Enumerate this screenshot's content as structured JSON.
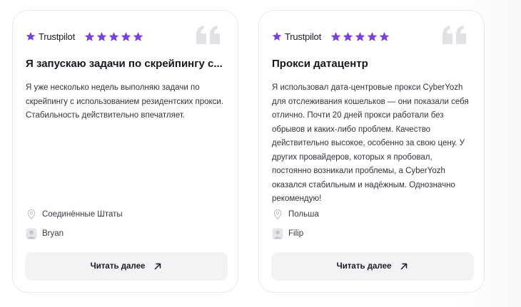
{
  "colors": {
    "accent_purple": "#7b3fe4",
    "quote_gray": "#e2e2e6",
    "button_bg": "#f3f3f5"
  },
  "reviews": [
    {
      "platform": "Trustpilot",
      "rating": 5,
      "title": "Я запускаю задачи по скрейпингу с...",
      "body": "Я уже несколько недель выполняю задачи по скрейпингу с использованием резидентских прокси. Стабильность действительно впечатляет.",
      "location": "Соединённые Штаты",
      "author": "Bryan",
      "read_more_label": "Читать далее"
    },
    {
      "platform": "Trustpilot",
      "rating": 5,
      "title": "Прокси датацентр",
      "body": "Я использовал дата-центровые прокси CyberYozh для отслеживания кошельков — они показали себя отлично. Почти 20 дней прокси работали без обрывов и каких-либо проблем. Качество действительно высокое, особенно за свою цену. У других провайдеров, которых я пробовал, постоянно возникали проблемы, а CyberYozh оказался стабильным и надёжным. Однозначно рекомендую!",
      "location": "Польша",
      "author": "Filip",
      "read_more_label": "Читать далее"
    }
  ]
}
